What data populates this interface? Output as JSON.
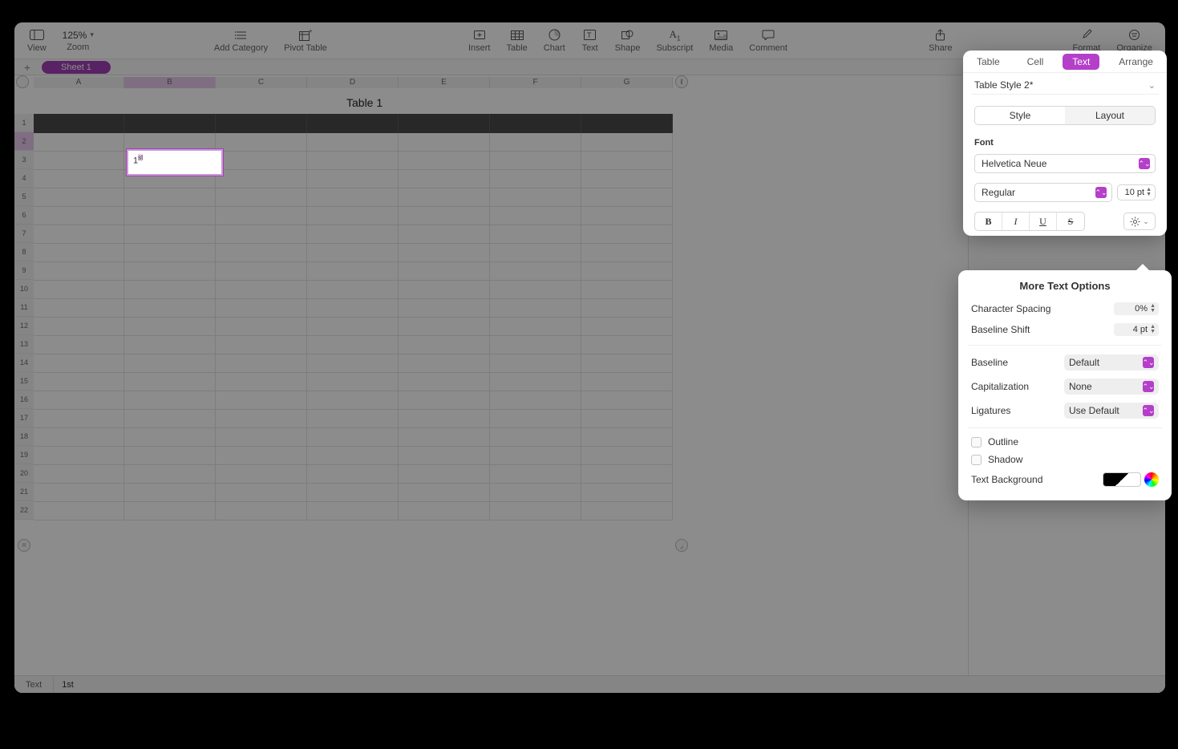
{
  "toolbar": {
    "view": "View",
    "zoom": "Zoom",
    "zoom_value": "125%",
    "add_category": "Add Category",
    "pivot_table": "Pivot Table",
    "insert": "Insert",
    "table": "Table",
    "chart": "Chart",
    "text": "Text",
    "shape": "Shape",
    "subscript": "Subscript",
    "media": "Media",
    "comment": "Comment",
    "share": "Share",
    "format": "Format",
    "organize": "Organize"
  },
  "sheet_tab": "Sheet 1",
  "table_title": "Table 1",
  "columns": [
    "A",
    "B",
    "C",
    "D",
    "E",
    "F",
    "G"
  ],
  "selected_col_index": 1,
  "rows": [
    "1",
    "2",
    "3",
    "4",
    "5",
    "6",
    "7",
    "8",
    "9",
    "10",
    "11",
    "12",
    "13",
    "14",
    "15",
    "16",
    "17",
    "18",
    "19",
    "20",
    "21",
    "22"
  ],
  "selected_row_index": 1,
  "edit_cell": {
    "base": "1",
    "sup": "st"
  },
  "formula_bar": {
    "label": "Text",
    "value": "1st"
  },
  "inspector": {
    "tabs": [
      "Table",
      "Cell",
      "Text",
      "Arrange"
    ],
    "active_tab": "Text",
    "table_style": "Table Style 2*",
    "seg_style": "Style",
    "seg_layout": "Layout",
    "font_label": "Font",
    "font_family": "Helvetica Neue",
    "font_weight": "Regular",
    "font_size": "10 pt",
    "bold": "B",
    "italic": "I",
    "underline": "U",
    "strike": "S"
  },
  "more_text": {
    "title": "More Text Options",
    "char_spacing_label": "Character Spacing",
    "char_spacing_value": "0%",
    "baseline_shift_label": "Baseline Shift",
    "baseline_shift_value": "4 pt",
    "baseline_label": "Baseline",
    "baseline_value": "Default",
    "capitalization_label": "Capitalization",
    "capitalization_value": "None",
    "ligatures_label": "Ligatures",
    "ligatures_value": "Use Default",
    "outline_label": "Outline",
    "shadow_label": "Shadow",
    "text_bg_label": "Text Background"
  }
}
